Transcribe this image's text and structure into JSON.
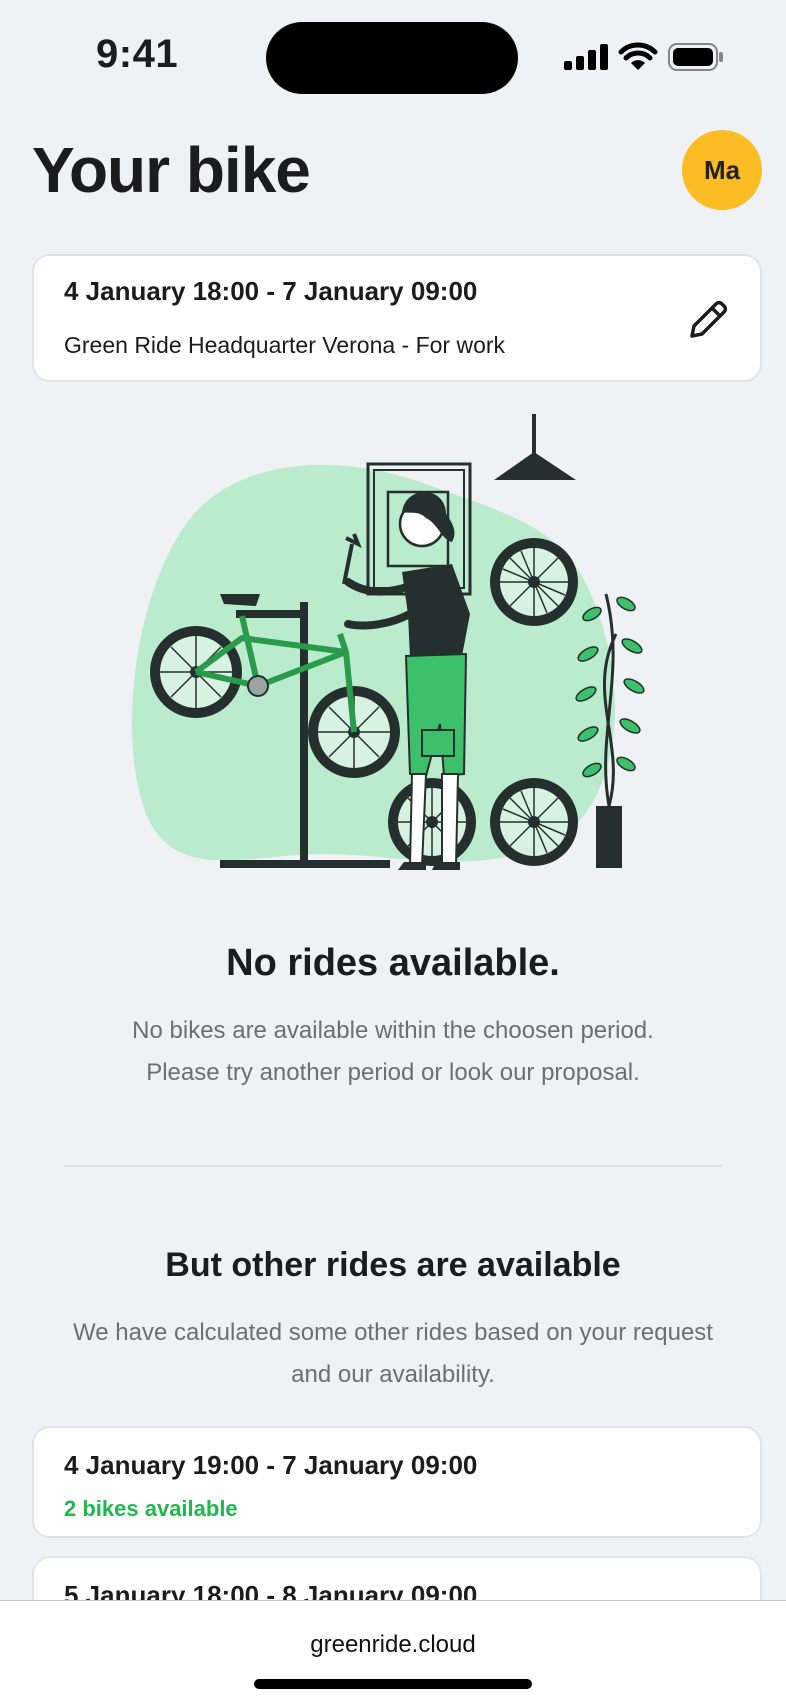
{
  "status": {
    "time": "9:41"
  },
  "header": {
    "title": "Your bike",
    "avatar_initials": "Ma"
  },
  "booking": {
    "period": "4 January 18:00 - 7 January 09:00",
    "location": "Green Ride Headquarter Verona - For work",
    "edit_icon": "pencil-icon"
  },
  "empty_state": {
    "title": "No rides available.",
    "line1": "No bikes are available within the choosen period.",
    "line2": "Please try another period or look our proposal."
  },
  "alternatives": {
    "title": "But other rides are available",
    "line1": "We have calculated some other rides based on your request",
    "line2": "and our availability.",
    "rides": [
      {
        "period": "4 January 19:00 - 7 January 09:00",
        "availability": "2 bikes available"
      },
      {
        "period": "5 January 18:00 - 8 January 09:00"
      }
    ]
  },
  "browser": {
    "url": "greenride.cloud"
  },
  "colors": {
    "accent_green": "#22b550",
    "avatar_yellow": "#fbbd23",
    "blob_green": "#b9ebcc"
  }
}
